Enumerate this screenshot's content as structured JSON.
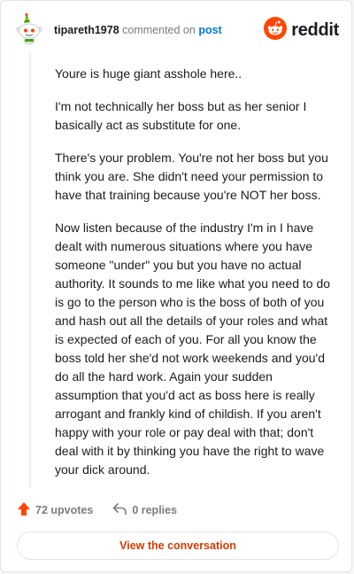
{
  "header": {
    "username": "tipareth1978",
    "action_text": "commented on",
    "post_link": "post",
    "brand": "reddit"
  },
  "comment": {
    "paragraphs": [
      "Youre is huge giant asshole here..",
      "I'm not technically her boss but as her senior I basically act as substitute for one.",
      "There's your problem. You're not her boss but you think you are. She didn't need your permission to have that training because you're NOT her boss.",
      "Now listen because of the industry I'm in I have dealt with numerous situations where you have someone \"under\" you but you have no actual authority. It sounds to me like what you need to do is go to the person who is the boss of both of you and hash out all the details of your roles and what is expected of each of you. For all you know the boss told her she'd not work weekends and you'd do all the hard work. Again your sudden assumption that you'd act as boss here is really arrogant and frankly kind of childish. If you aren't happy with your role or pay deal with that; don't deal with it by thinking you have the right to wave your dick around."
    ]
  },
  "footer": {
    "upvotes": "72 upvotes",
    "replies": "0 replies",
    "view_button": "View the conversation"
  },
  "icons": {
    "avatar": "snoo-avatar-icon",
    "logo": "reddit-logo-icon",
    "upvote": "upvote-arrow-icon",
    "reply": "reply-arrow-icon"
  },
  "colors": {
    "brand_orange": "#ff4500",
    "link_blue": "#0079d3",
    "button_text": "#d93a00",
    "muted": "#7c7c7c"
  }
}
